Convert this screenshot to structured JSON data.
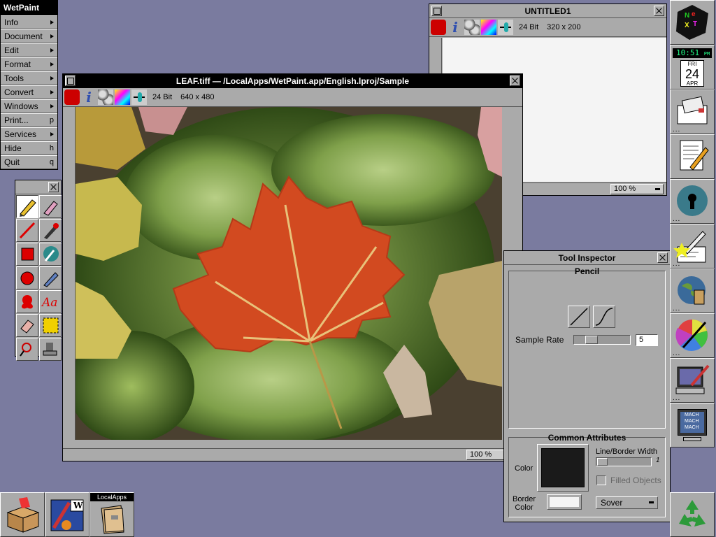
{
  "menu": {
    "title": "WetPaint",
    "items": [
      {
        "label": "Info",
        "key": ""
      },
      {
        "label": "Document",
        "key": ""
      },
      {
        "label": "Edit",
        "key": ""
      },
      {
        "label": "Format",
        "key": ""
      },
      {
        "label": "Tools",
        "key": ""
      },
      {
        "label": "Convert",
        "key": ""
      },
      {
        "label": "Windows",
        "key": ""
      },
      {
        "label": "Print...",
        "key": "p"
      },
      {
        "label": "Services",
        "key": ""
      },
      {
        "label": "Hide",
        "key": "h"
      },
      {
        "label": "Quit",
        "key": "q"
      }
    ]
  },
  "untitled_window": {
    "title": "UNTITLED1",
    "depth": "24 Bit",
    "size": "320 x 200",
    "zoom": "100 %"
  },
  "leaf_window": {
    "title": "LEAF.tiff  — /LocalApps/WetPaint.app/English.lproj/Sample",
    "depth": "24 Bit",
    "size": "640 x 480",
    "zoom": "100 %"
  },
  "inspector": {
    "title": "Tool Inspector",
    "tool_name": "Pencil",
    "sample_rate_label": "Sample Rate",
    "sample_rate_value": "5",
    "sample_rate_fraction": 0.25,
    "common_title": "Common Attributes",
    "color_label": "Color",
    "line_width_label": "Line/Border Width",
    "line_width_value": "1",
    "filled_label": "Filled Objects",
    "border_color_label": "Border\nColor",
    "mode_label": "Sover",
    "color_value": "#1a1a1a",
    "border_color_value": "#f4f4f4"
  },
  "dock": {
    "clock_time": "10:51",
    "clock_ampm": "PM",
    "clock_day": "FRI",
    "clock_date": "24",
    "clock_month": "APR",
    "mach_lines": [
      "MACH",
      "MACH",
      "MACH"
    ]
  },
  "shelf": {
    "localapps_label": "LocalApps"
  }
}
